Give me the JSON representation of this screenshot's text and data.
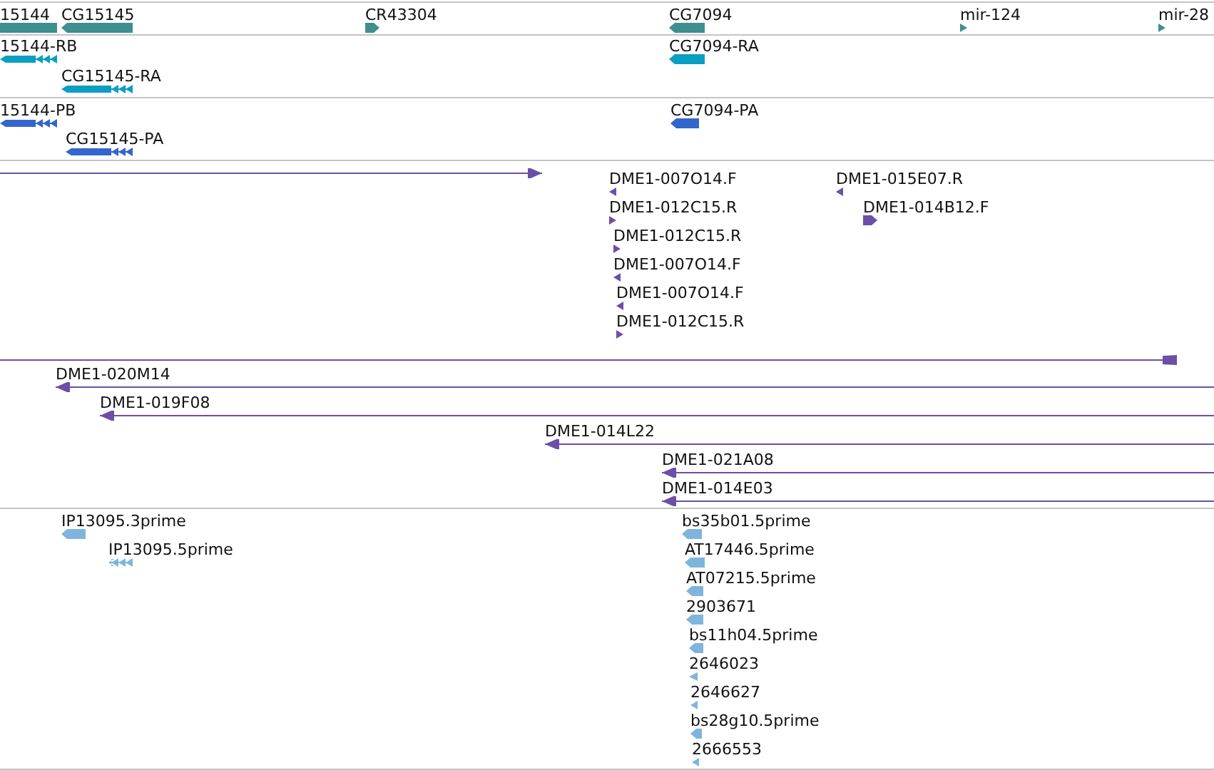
{
  "tracks": [
    {
      "color": "#3f8f8f",
      "features": [
        {
          "label": "15144",
          "kind": "bar"
        },
        {
          "label": "CG15145",
          "kind": "bar",
          "reverse": true
        },
        {
          "label": "CR43304",
          "kind": "bar",
          "reverse": false
        },
        {
          "label": "CG7094",
          "kind": "bar",
          "reverse": true
        },
        {
          "label": "mir-124",
          "kind": "mark",
          "reverse": false
        },
        {
          "label": "mir-28",
          "kind": "mark",
          "reverse": false
        }
      ]
    },
    {
      "color": "#0a9fc2",
      "features": [
        {
          "label": "15144-RB",
          "kind": "transcript",
          "reverse": true
        },
        {
          "label": "CG15145-RA",
          "kind": "transcript",
          "reverse": true
        },
        {
          "label": "CG7094-RA",
          "kind": "bar",
          "reverse": true
        }
      ]
    },
    {
      "color": "#3366cc",
      "features": [
        {
          "label": "15144-PB",
          "kind": "transcript",
          "reverse": true
        },
        {
          "label": "CG15145-PA",
          "kind": "transcript",
          "reverse": true
        },
        {
          "label": "CG7094-PA",
          "kind": "bar",
          "reverse": true
        }
      ]
    },
    {
      "color": "#6b4fa8",
      "features": [
        {
          "kind": "line",
          "reverse": false
        },
        {
          "label": "DME1-007O14.F",
          "kind": "mark",
          "reverse": true
        },
        {
          "label": "DME1-012C15.R",
          "kind": "mark",
          "reverse": false
        },
        {
          "label": "DME1-012C15.R",
          "kind": "mark",
          "reverse": false
        },
        {
          "label": "DME1-007O14.F",
          "kind": "mark",
          "reverse": true
        },
        {
          "label": "DME1-007O14.F",
          "kind": "mark",
          "reverse": true
        },
        {
          "label": "DME1-012C15.R",
          "kind": "mark",
          "reverse": false
        },
        {
          "label": "DME1-015E07.R",
          "kind": "mark",
          "reverse": true
        },
        {
          "label": "DME1-014B12.F",
          "kind": "bar",
          "reverse": false
        },
        {
          "kind": "line"
        },
        {
          "label": "DME1-020M14",
          "kind": "line",
          "reverse": true
        },
        {
          "label": "DME1-019F08",
          "kind": "line",
          "reverse": true
        },
        {
          "label": "DME1-014L22",
          "kind": "line",
          "reverse": true
        },
        {
          "label": "DME1-021A08",
          "kind": "line",
          "reverse": true
        },
        {
          "label": "DME1-014E03",
          "kind": "line",
          "reverse": true
        }
      ]
    },
    {
      "color": "#7fb5dc",
      "features": [
        {
          "label": "IP13095.3prime",
          "kind": "bar",
          "reverse": true
        },
        {
          "label": "IP13095.5prime",
          "kind": "transcript",
          "reverse": true
        },
        {
          "label": "bs35b01.5prime",
          "kind": "bar",
          "reverse": true
        },
        {
          "label": "AT17446.5prime",
          "kind": "bar",
          "reverse": true
        },
        {
          "label": "AT07215.5prime",
          "kind": "bar",
          "reverse": true
        },
        {
          "label": "2903671",
          "kind": "bar",
          "reverse": true
        },
        {
          "label": "bs11h04.5prime",
          "kind": "bar",
          "reverse": true
        },
        {
          "label": "2646023",
          "kind": "mark",
          "reverse": true
        },
        {
          "label": "2646627",
          "kind": "mark",
          "reverse": true
        },
        {
          "label": "bs28g10.5prime",
          "kind": "bar",
          "reverse": true
        },
        {
          "label": "2666553",
          "kind": "mark",
          "reverse": true
        }
      ]
    }
  ]
}
